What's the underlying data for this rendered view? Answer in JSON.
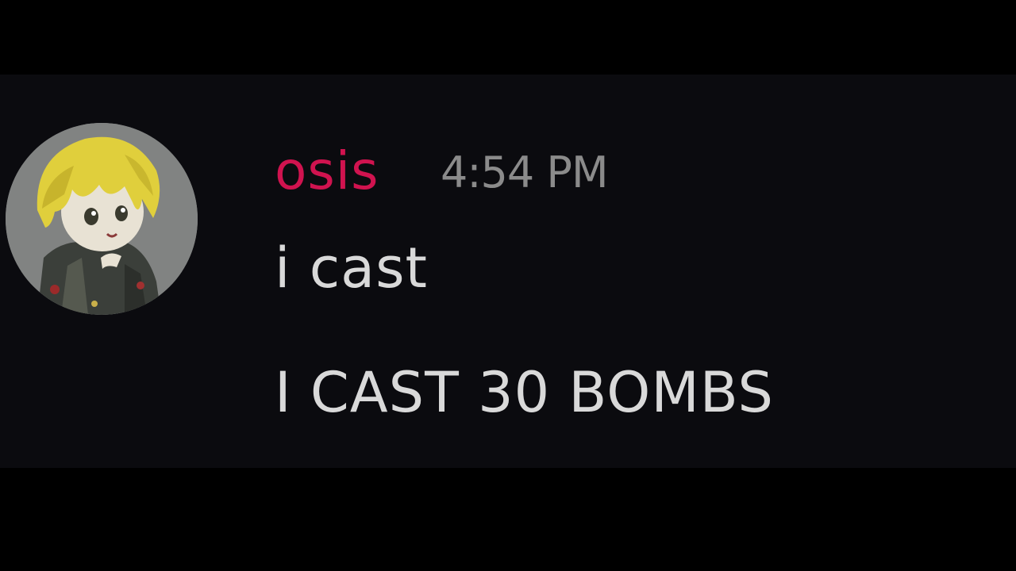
{
  "colors": {
    "background": "#000000",
    "panel": "#0b0b0f",
    "username": "#d0134f",
    "timestamp": "#8b8b8b",
    "message_text": "#d9d9d9"
  },
  "message": {
    "author": "osis",
    "timestamp": "4:54 PM",
    "avatar_icon": "anime-character-avatar",
    "lines": [
      "i cast",
      "I CAST 30 BOMBS"
    ]
  }
}
